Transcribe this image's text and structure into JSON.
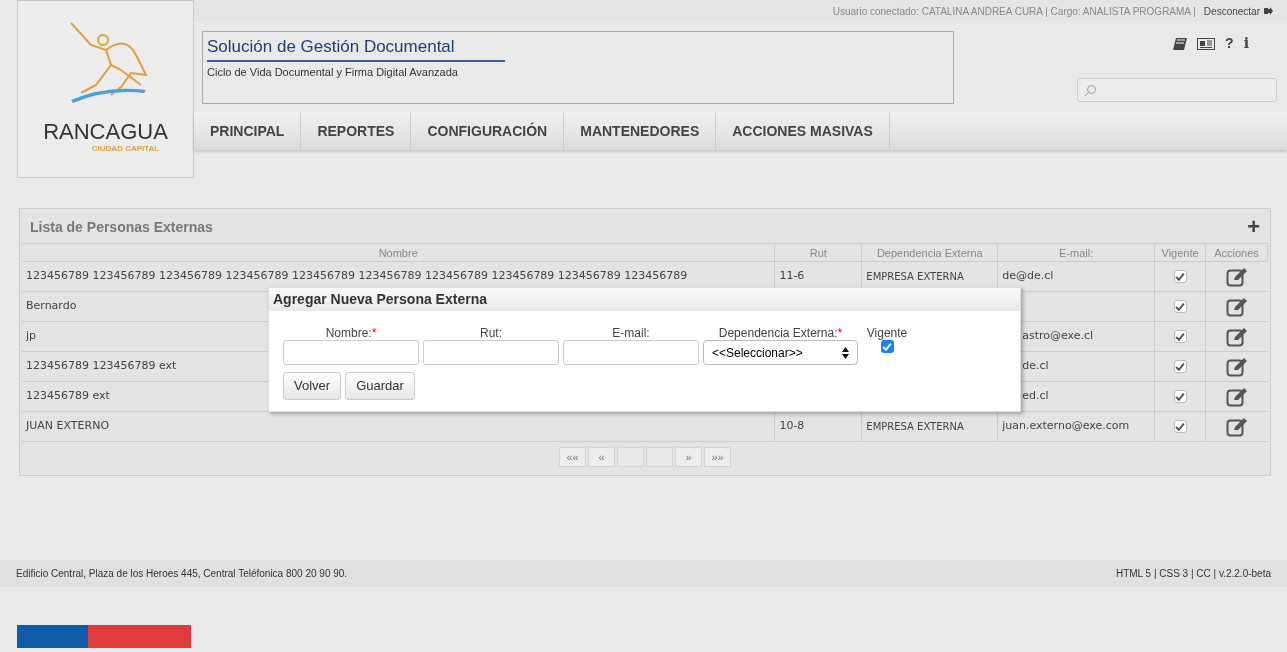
{
  "top_bar": {
    "user_info": "Usuario conectado: CATALINA ANDREA CURA | Cargo: ANALISTA PROGRAMA |",
    "logout": "Desconectar"
  },
  "logo": {
    "name": "RANCAGUA",
    "tagline": "CIUDAD CAPITAL"
  },
  "header": {
    "title": "Solución de Gestión Documental",
    "subtitle": "Ciclo de Vida Documental y Firma Digital Avanzada"
  },
  "toolbar": {
    "help": "?",
    "info": "i"
  },
  "nav": [
    "PRINCIPAL",
    "REPORTES",
    "CONFIGURACIÓN",
    "MANTENEDORES",
    "ACCIONES MASIVAS"
  ],
  "panel": {
    "title": "Lista de Personas Externas",
    "add": "+"
  },
  "table": {
    "columns": [
      "Nombre",
      "Rut",
      "Dependencia Externa",
      "E-mail:",
      "Vigente",
      "Acciones"
    ],
    "rows": [
      {
        "nombre": "123456789 123456789 123456789 123456789 123456789 123456789 123456789 123456789 123456789 123456789",
        "rut": "11-6",
        "dependencia": "EMPRESA EXTERNA",
        "email": "de@de.cl",
        "vigente": true
      },
      {
        "nombre": "Bernardo",
        "vigente": true
      },
      {
        "nombre": "jp",
        "email": "astro@exe.cl",
        "vigente": true
      },
      {
        "nombre": "123456789 123456789 ext",
        "email": "de.cl",
        "vigente": true
      },
      {
        "nombre": "123456789 ext",
        "email": "ed.cl",
        "vigente": true
      },
      {
        "nombre": "JUAN EXTERNO",
        "rut": "10-8",
        "dependencia": "EMPRESA EXTERNA",
        "email": "juan.externo@exe.com",
        "vigente": true
      }
    ]
  },
  "pager": {
    "first": "««",
    "prev": "«",
    "next": "»",
    "last": "»»"
  },
  "modal": {
    "title": "Agregar Nueva Persona Externa",
    "fields": [
      {
        "label": "Nombre:",
        "required_mark": "*",
        "kind": "text"
      },
      {
        "label": "Rut:",
        "kind": "text"
      },
      {
        "label": "E-mail:",
        "kind": "text"
      },
      {
        "label": "Dependencia Externa:",
        "required_mark": "*",
        "kind": "select",
        "value": "<<Seleccionar>>"
      },
      {
        "label": "Vigente",
        "kind": "checkbox",
        "checked": true
      }
    ],
    "buttons": [
      "Volver",
      "Guardar"
    ]
  },
  "footer": {
    "address": "Edificio Central, Plaza de los Heroes 445, Central Teléfonica 800 20 90 90.",
    "version": "HTML 5 | CSS 3 | CC | v.2.2.0-beta"
  }
}
